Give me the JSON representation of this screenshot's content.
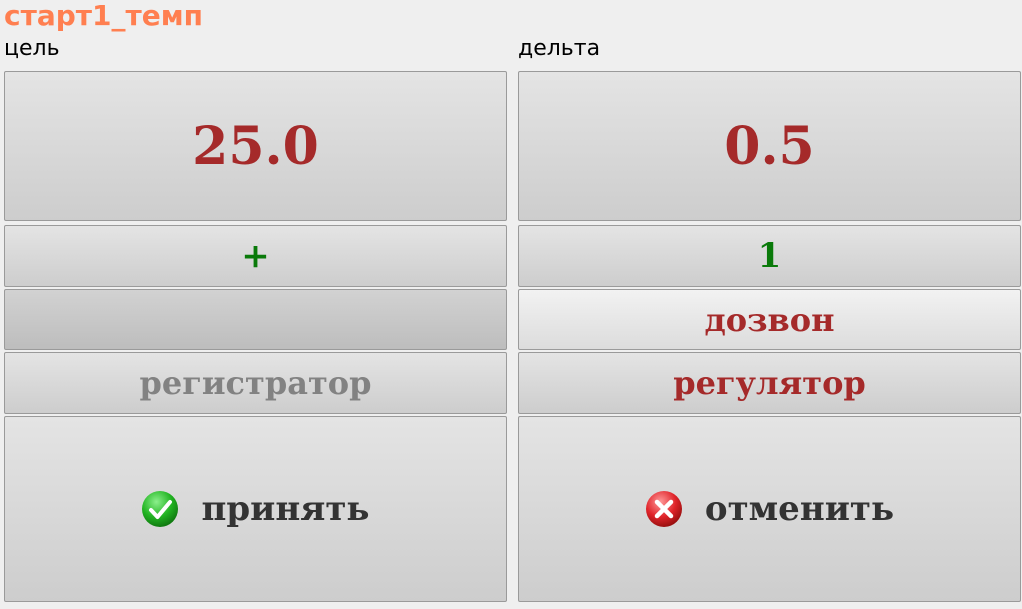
{
  "window": {
    "title": "старт1_темп"
  },
  "labels": {
    "target": "цель",
    "delta": "дельта"
  },
  "target": {
    "value": "25.0",
    "step_button": "+"
  },
  "delta": {
    "value": "0.5",
    "step_button": "1"
  },
  "buttons": {
    "empty": "",
    "dial": "дозвон",
    "recorder": "регистратор",
    "regulator": "регулятор",
    "accept": "принять",
    "cancel": "отменить"
  },
  "icons": {
    "accept": "check-circle-icon",
    "cancel": "x-circle-icon"
  },
  "colors": {
    "title": "#ff7f50",
    "value": "#a52a2a",
    "step": "#0a7a0a",
    "disabled": "#828282",
    "accept_icon": "#22b422",
    "cancel_icon": "#e0242a"
  }
}
